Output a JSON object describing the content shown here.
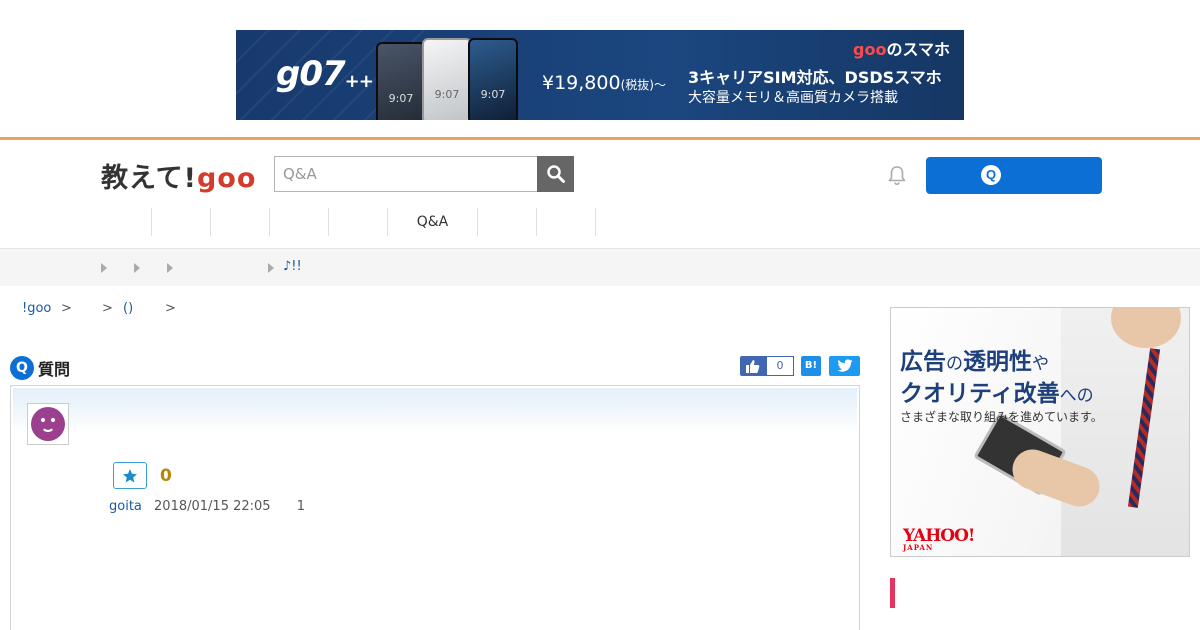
{
  "top_ad": {
    "model": "g07",
    "model_suffix": "++",
    "phone_clock": "9:07",
    "brand_prefix": "goo",
    "brand_suffix": "のスマホ",
    "price": "¥19,800",
    "price_note": "(税抜)〜",
    "copy1": "3キャリアSIM対応、DSDSスマホ",
    "copy2": "大容量メモリ＆高画質カメラ搭載"
  },
  "header": {
    "logo_text": "教えて!",
    "logo_brand": "goo",
    "search_placeholder": "Q&A",
    "ask_icon": "Q"
  },
  "nav": {
    "items": [
      "",
      "",
      "",
      "",
      "",
      "Q&A",
      "",
      ""
    ]
  },
  "subnav": {
    "label": "♪!!"
  },
  "breadcrumb": {
    "home": "!goo",
    "sep1": ">",
    "sep2": ">",
    "category": "()",
    "sep3": ">"
  },
  "question": {
    "badge": "Q",
    "title": "質問",
    "fb_count": "0",
    "hatena": "B!",
    "favorite_count": "0",
    "user": "goita",
    "datetime": "2018/01/15 22:05",
    "answers": "1"
  },
  "side_ad": {
    "line1_a": "広告",
    "line1_b": "の",
    "line1_c": "透明性",
    "line1_d": "や",
    "line2_a": "クオリティ改善",
    "line2_b": "への",
    "line3": "さまざまな取り組みを進めています。",
    "sponsor": "YAHOO!",
    "sponsor_sub": "JAPAN"
  },
  "colors": {
    "accent_blue": "#0b6fd6",
    "header_line": "#e8a15a",
    "logo_red": "#d33b2c",
    "marker_pink": "#e33560"
  }
}
